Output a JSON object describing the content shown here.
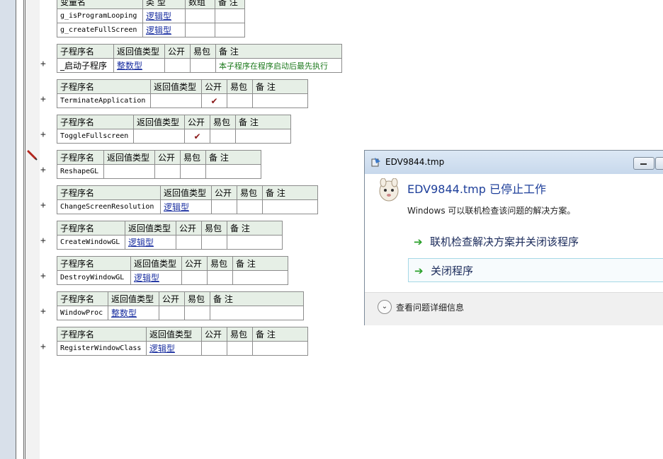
{
  "var_table": {
    "headers": [
      "变量名",
      "类 型",
      "数组",
      "备 注"
    ],
    "rows": [
      {
        "name": "g_isProgramLooping",
        "type": "逻辑型"
      },
      {
        "name": "g_createFullScreen",
        "type": "逻辑型"
      }
    ]
  },
  "sub_headers": {
    "name": "子程序名",
    "ret": "返回值类型",
    "pub": "公开",
    "easy": "易包",
    "note": "备 注"
  },
  "subroutines": [
    {
      "name": "_启动子程序",
      "ret": "整数型",
      "pub": "",
      "note": "本子程序在程序启动后最先执行"
    },
    {
      "name": "TerminateApplication",
      "ret": "",
      "pub": "✔",
      "note": ""
    },
    {
      "name": "ToggleFullscreen",
      "ret": "",
      "pub": "✔",
      "note": ""
    },
    {
      "name": "ReshapeGL",
      "ret": "",
      "pub": "",
      "note": ""
    },
    {
      "name": "ChangeScreenResolution",
      "ret": "逻辑型",
      "pub": "",
      "note": ""
    },
    {
      "name": "CreateWindowGL",
      "ret": "逻辑型",
      "pub": "",
      "note": ""
    },
    {
      "name": "DestroyWindowGL",
      "ret": "逻辑型",
      "pub": "",
      "note": ""
    },
    {
      "name": "WindowProc",
      "ret": "整数型",
      "pub": "",
      "note": ""
    },
    {
      "name": "RegisterWindowClass",
      "ret": "逻辑型",
      "pub": "",
      "note": ""
    }
  ],
  "plus_symbol": "+",
  "dialog": {
    "title": "EDV9844.tmp",
    "heading": "EDV9844.tmp 已停止工作",
    "subtext": "Windows 可以联机检查该问题的解决方案。",
    "option1": "联机检查解决方案并关闭该程序",
    "option2": "关闭程序",
    "details": "查看问题详细信息",
    "arrow_glyph": "➔",
    "chevron_glyph": "⌄"
  }
}
